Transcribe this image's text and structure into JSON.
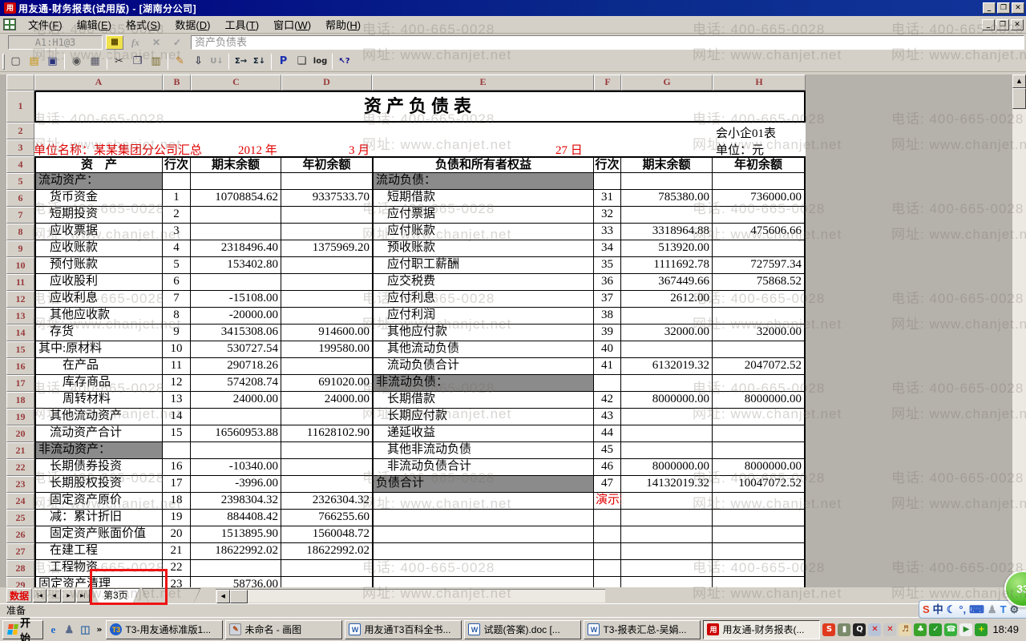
{
  "window": {
    "title": "用友通-财务报表(试用版) - [湖南分公司]",
    "controls": {
      "minimize": "_",
      "restore": "❐",
      "close": "✕"
    }
  },
  "menu": {
    "items": [
      {
        "label": "文件",
        "key": "F"
      },
      {
        "label": "编辑",
        "key": "E"
      },
      {
        "label": "格式",
        "key": "S"
      },
      {
        "label": "数据",
        "key": "D"
      },
      {
        "label": "工具",
        "key": "T"
      },
      {
        "label": "窗口",
        "key": "W"
      },
      {
        "label": "帮助",
        "key": "H"
      }
    ]
  },
  "formula_bar": {
    "name_box": "A1:H1@3",
    "keyboard_btn": "▦",
    "fx_label": "fx",
    "cancel_label": "✕",
    "confirm_label": "✓",
    "formula": "资产负债表"
  },
  "toolbar": {
    "icons": [
      {
        "name": "new-icon",
        "glyph": "▢",
        "color": "#444"
      },
      {
        "name": "open-icon",
        "glyph": "▤",
        "color": "#c8920a"
      },
      {
        "name": "save-icon",
        "glyph": "▣",
        "color": "#28327d"
      },
      {
        "name": "print-preview-icon",
        "glyph": "◉",
        "color": "#555",
        "sep_before": true
      },
      {
        "name": "print-icon",
        "glyph": "▦",
        "color": "#556"
      },
      {
        "name": "cut-icon",
        "glyph": "✂",
        "color": "#333",
        "sep_before": true
      },
      {
        "name": "copy-icon",
        "glyph": "❐",
        "color": "#335",
        "small": false
      },
      {
        "name": "paste-icon",
        "glyph": "▥",
        "color": "#7a6a2a"
      },
      {
        "name": "format-painter-icon",
        "glyph": "✎",
        "color": "#c87f1e",
        "sep_before": true
      },
      {
        "name": "insert-down-icon",
        "glyph": "⇩",
        "color": "#334"
      },
      {
        "name": "fill-down-icon",
        "glyph": "U↓",
        "color": "#9a9a9a",
        "small": true
      },
      {
        "name": "sum-row-icon",
        "glyph": "Σ→",
        "color": "#123",
        "sep_before": true,
        "small": true
      },
      {
        "name": "sum-col-icon",
        "glyph": "Σ↓",
        "color": "#123",
        "small": true
      },
      {
        "name": "precision-icon",
        "glyph": "P",
        "color": "#1a2fb0",
        "sep_before": true
      },
      {
        "name": "page-icon",
        "glyph": "❏",
        "color": "#333"
      },
      {
        "name": "log-icon",
        "glyph": "log",
        "color": "#222",
        "small": true
      },
      {
        "name": "help-icon",
        "glyph": "↖?",
        "color": "#14148c",
        "sep_before": true,
        "small": true
      }
    ]
  },
  "sheet": {
    "columns": [
      "A",
      "B",
      "C",
      "D",
      "E",
      "F",
      "G",
      "H"
    ],
    "gutter": {
      "r1": "1",
      "r2": "2",
      "r3": "3",
      "r4": "4"
    },
    "title": "资产负债表",
    "doc_no": "会小企01表",
    "unit_name": "单位名称：某某集团分公司汇总",
    "year": "2012 年",
    "month": "3 月",
    "day": "27 日",
    "unit_label": "单位：元",
    "header": {
      "asset": "资　产",
      "line": "行次",
      "end": "期末余额",
      "begin": "年初余额",
      "liability": "负债和所有者权益"
    },
    "rows": [
      {
        "n": 5,
        "a": "流动资产：",
        "ia": 0,
        "ga": 1,
        "e": "流动负债：",
        "ie": 0,
        "ge": 1
      },
      {
        "n": 6,
        "a": "货币资金",
        "b": "1",
        "c": "10708854.62",
        "d": "9337533.70",
        "e": "短期借款",
        "f": "31",
        "g": "785380.00",
        "h": "736000.00"
      },
      {
        "n": 7,
        "a": "短期投资",
        "b": "2",
        "e": "应付票据",
        "f": "32"
      },
      {
        "n": 8,
        "a": "应收票据",
        "b": "3",
        "e": "应付账款",
        "f": "33",
        "g": "3318964.88",
        "h": "475606.66"
      },
      {
        "n": 9,
        "a": "应收账款",
        "b": "4",
        "c": "2318496.40",
        "d": "1375969.20",
        "e": "预收账款",
        "f": "34",
        "g": "513920.00"
      },
      {
        "n": 10,
        "a": "预付账款",
        "b": "5",
        "c": "153402.80",
        "e": "应付职工薪酬",
        "f": "35",
        "g": "1111692.78",
        "h": "727597.34"
      },
      {
        "n": 11,
        "a": "应收股利",
        "b": "6",
        "e": "应交税费",
        "f": "36",
        "g": "367449.66",
        "h": "75868.52"
      },
      {
        "n": 12,
        "a": "应收利息",
        "b": "7",
        "c": "-15108.00",
        "e": "应付利息",
        "f": "37",
        "g": "2612.00"
      },
      {
        "n": 13,
        "a": "其他应收款",
        "b": "8",
        "c": "-20000.00",
        "e": "应付利润",
        "f": "38"
      },
      {
        "n": 14,
        "a": "存货",
        "b": "9",
        "c": "3415308.06",
        "d": "914600.00",
        "e": "其他应付款",
        "f": "39",
        "g": "32000.00",
        "h": "32000.00"
      },
      {
        "n": 15,
        "a": "其中:原材料",
        "ia": 0,
        "b": "10",
        "c": "530727.54",
        "d": "199580.00",
        "e": "其他流动负债",
        "f": "40"
      },
      {
        "n": 16,
        "a": "在产品",
        "ia": 2,
        "b": "11",
        "c": "290718.26",
        "e": "流动负债合计",
        "f": "41",
        "g": "6132019.32",
        "h": "2047072.52"
      },
      {
        "n": 17,
        "a": "库存商品",
        "ia": 2,
        "b": "12",
        "c": "574208.74",
        "d": "691020.00",
        "e": "非流动负债：",
        "ie": 0,
        "ge": 1
      },
      {
        "n": 18,
        "a": "周转材料",
        "ia": 2,
        "b": "13",
        "c": "24000.00",
        "d": "24000.00",
        "e": "长期借款",
        "f": "42",
        "g": "8000000.00",
        "h": "8000000.00"
      },
      {
        "n": 19,
        "a": "其他流动资产",
        "b": "14",
        "e": "长期应付款",
        "f": "43"
      },
      {
        "n": 20,
        "a": "流动资产合计",
        "b": "15",
        "c": "16560953.88",
        "d": "11628102.90",
        "e": "递延收益",
        "f": "44"
      },
      {
        "n": 21,
        "a": "非流动资产：",
        "ia": 0,
        "ga": 1,
        "e": "其他非流动负债",
        "f": "45"
      },
      {
        "n": 22,
        "a": "长期债券投资",
        "b": "16",
        "c": "-10340.00",
        "e": "非流动负债合计",
        "f": "46",
        "g": "8000000.00",
        "h": "8000000.00"
      },
      {
        "n": 23,
        "a": "长期股权投资",
        "b": "17",
        "c": "-3996.00",
        "e": "负债合计",
        "ie": 0,
        "ge": 1,
        "f": "47",
        "g": "14132019.32",
        "h": "10047072.52"
      },
      {
        "n": 24,
        "a": "固定资产原价",
        "b": "18",
        "c": "2398304.32",
        "d": "2326304.32",
        "f": "演示数据",
        "fr": 1
      },
      {
        "n": 25,
        "a": "减：累计折旧",
        "b": "19",
        "c": "884408.42",
        "d": "766255.60"
      },
      {
        "n": 26,
        "a": "固定资产账面价值",
        "b": "20",
        "c": "1513895.90",
        "d": "1560048.72"
      },
      {
        "n": 27,
        "a": "在建工程",
        "b": "21",
        "c": "18622992.02",
        "d": "18622992.02"
      },
      {
        "n": 28,
        "a": "工程物资",
        "b": "22"
      },
      {
        "n": 29,
        "a": "固定资产清理",
        "ia": 0,
        "b": "23",
        "c": "58736.00"
      }
    ]
  },
  "tabs": {
    "data_label": "数据",
    "nav": [
      "|◀",
      "◀",
      "▶",
      "▶|"
    ],
    "sheet_tab": "第3页",
    "hscroll_left": "◀"
  },
  "scrollbar": {
    "up": "▲",
    "down": "▼"
  },
  "status": {
    "text": "准备"
  },
  "taskbar": {
    "start": "开始",
    "quick_launch": [
      {
        "name": "ie-icon",
        "glyph": "e",
        "color": "#1b66c9"
      },
      {
        "name": "msn-icon",
        "glyph": "♟",
        "color": "#5a6b8c"
      },
      {
        "name": "outlook-icon",
        "glyph": "◫",
        "color": "#3a6ea5"
      }
    ],
    "overflow_chevron": "»",
    "buttons": [
      {
        "icon": "t3-app",
        "glyph": "T3",
        "label": "T3-用友通标准版1..."
      },
      {
        "icon": "paint",
        "glyph": "✎",
        "label": "未命名 - 画图"
      },
      {
        "icon": "word",
        "glyph": "W",
        "label": "用友通T3百科全书..."
      },
      {
        "icon": "word",
        "glyph": "W",
        "label": "试题(答案).doc [..."
      },
      {
        "icon": "word",
        "glyph": "W",
        "label": "T3-报表汇总-吴娟..."
      },
      {
        "icon": "ufida",
        "glyph": "用",
        "label": "用友通-财务报表(...",
        "active": true
      }
    ],
    "tray": [
      {
        "name": "sogou-tray-icon",
        "glyph": "S",
        "fg": "#fff",
        "bg": "#e03a1e"
      },
      {
        "name": "usb-device-icon",
        "glyph": "▮",
        "fg": "#fff",
        "bg": "#7a8a6a"
      },
      {
        "name": "qq-penguin-icon",
        "glyph": "Q",
        "fg": "#fff",
        "bg": "#222"
      },
      {
        "name": "network-error-icon",
        "glyph": "✕",
        "fg": "#d00",
        "bg": "#b8c4d8"
      },
      {
        "name": "device-error-icon",
        "glyph": "✕",
        "fg": "#d00",
        "bg": "#c8c8c8"
      },
      {
        "name": "volume-icon",
        "glyph": "♬",
        "fg": "#8a4a10",
        "bg": "#e8d8b0"
      },
      {
        "name": "thunder-icon",
        "glyph": "♣",
        "fg": "#fff",
        "bg": "#3aa32a"
      },
      {
        "name": "shield-icon",
        "glyph": "✓",
        "fg": "#fff",
        "bg": "#2a9a2a"
      },
      {
        "name": "messenger-icon",
        "glyph": "☎",
        "fg": "#fff",
        "bg": "#38b03c"
      },
      {
        "name": "media-icon",
        "glyph": "▶",
        "fg": "#2a8a2a",
        "bg": "#f0f0f0"
      },
      {
        "name": "update-icon",
        "glyph": "+",
        "fg": "#ffe400",
        "bg": "#2aa02a"
      }
    ],
    "clock": "18:49"
  },
  "sogou_bar": {
    "icons": [
      {
        "name": "sogou-logo-icon",
        "glyph": "S",
        "color": "#e03a1e"
      },
      {
        "name": "chinese-mode-icon",
        "glyph": "中",
        "color": "#1a3a8c"
      },
      {
        "name": "fullwidth-icon",
        "glyph": "☾",
        "color": "#2a5cc8"
      },
      {
        "name": "punctuation-icon",
        "glyph": "°,",
        "color": "#2a5cc8"
      },
      {
        "name": "soft-keyboard-icon",
        "glyph": "⌨",
        "color": "#2a5cc8"
      },
      {
        "name": "account-icon",
        "glyph": "♟",
        "color": "#9aa0a8"
      },
      {
        "name": "skin-icon",
        "glyph": "T",
        "color": "#2a7ae0"
      },
      {
        "name": "toolbox-icon",
        "glyph": "⚙",
        "color": "#4a5a6a"
      }
    ]
  },
  "green_ball": {
    "text": "33"
  },
  "watermark": {
    "phone": "电话: 400-665-0028",
    "web": "网址: www.chanjet.net"
  },
  "colors": {
    "titlebar": "#000080",
    "red_text": "#e00000",
    "section_gray": "#8b8b8b",
    "header_letter": "#993a3a"
  }
}
